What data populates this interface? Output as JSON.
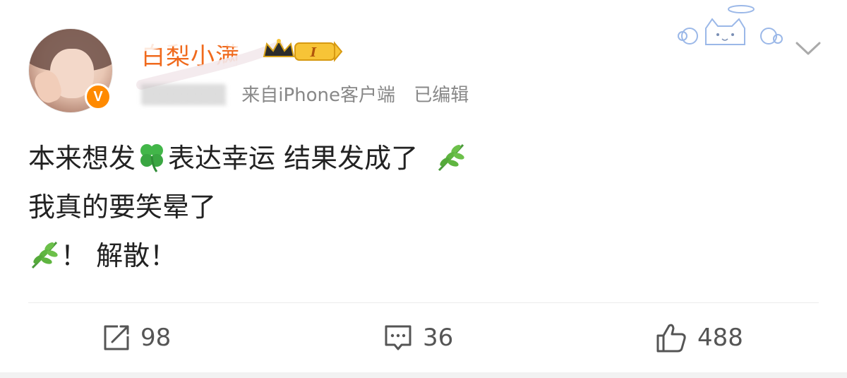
{
  "post": {
    "username": "白梨小满",
    "badge_level": "I",
    "source": "来自iPhone客户端",
    "edited": "已编辑",
    "content_lines": [
      {
        "before": "本来想发",
        "mid": "表达幸运 结果发成了"
      },
      {
        "text": "我真的要笑晕了"
      },
      {
        "after": "！ 解散！"
      }
    ],
    "emojis": [
      "clover-icon",
      "herb-icon"
    ]
  },
  "actions": {
    "repost_count": "98",
    "comment_count": "36",
    "like_count": "488"
  },
  "colors": {
    "username": "#f06a1d",
    "meta": "#888888",
    "text": "#222222"
  }
}
